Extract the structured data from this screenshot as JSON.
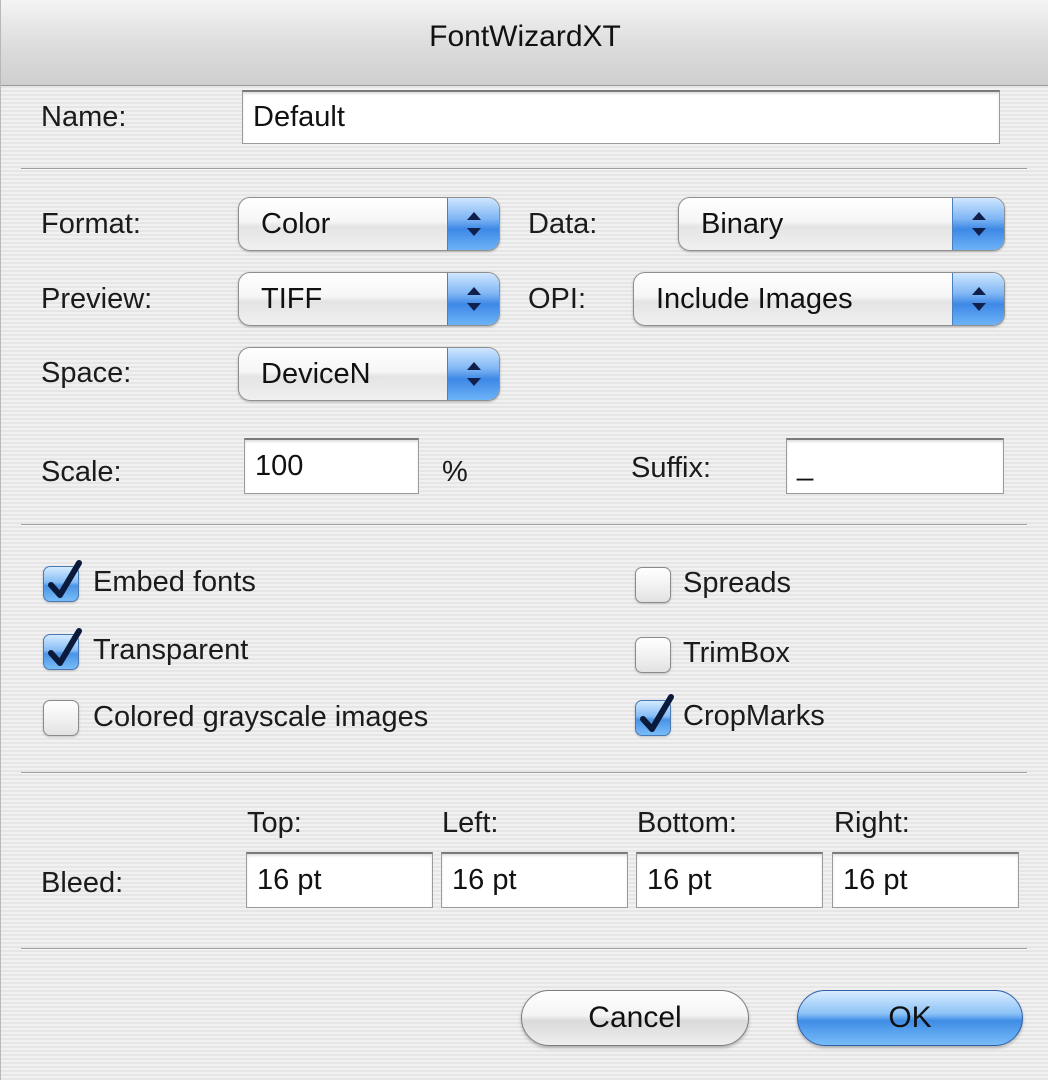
{
  "window": {
    "title": "FontWizardXT"
  },
  "name": {
    "label": "Name:",
    "value": "Default"
  },
  "format": {
    "label": "Format:",
    "value": "Color"
  },
  "data": {
    "label": "Data:",
    "value": "Binary"
  },
  "preview": {
    "label": "Preview:",
    "value": "TIFF"
  },
  "opi": {
    "label": "OPI:",
    "value": "Include Images"
  },
  "space": {
    "label": "Space:",
    "value": "DeviceN"
  },
  "scale": {
    "label": "Scale:",
    "value": "100",
    "unit": "%"
  },
  "suffix": {
    "label": "Suffix:",
    "value": "_"
  },
  "options": {
    "embed_fonts": {
      "label": "Embed fonts",
      "checked": true
    },
    "transparent": {
      "label": "Transparent",
      "checked": true
    },
    "colored_grayscale": {
      "label": "Colored grayscale images",
      "checked": false
    },
    "spreads": {
      "label": "Spreads",
      "checked": false
    },
    "trimbox": {
      "label": "TrimBox",
      "checked": false
    },
    "cropmarks": {
      "label": "CropMarks",
      "checked": true
    }
  },
  "bleed": {
    "label": "Bleed:",
    "top": {
      "label": "Top:",
      "value": "16 pt"
    },
    "left": {
      "label": "Left:",
      "value": "16 pt"
    },
    "bottom": {
      "label": "Bottom:",
      "value": "16 pt"
    },
    "right": {
      "label": "Right:",
      "value": "16 pt"
    }
  },
  "buttons": {
    "cancel": "Cancel",
    "ok": "OK"
  },
  "colors": {
    "accent_blue": "#4b93e6",
    "window_bg": "#ececec"
  }
}
